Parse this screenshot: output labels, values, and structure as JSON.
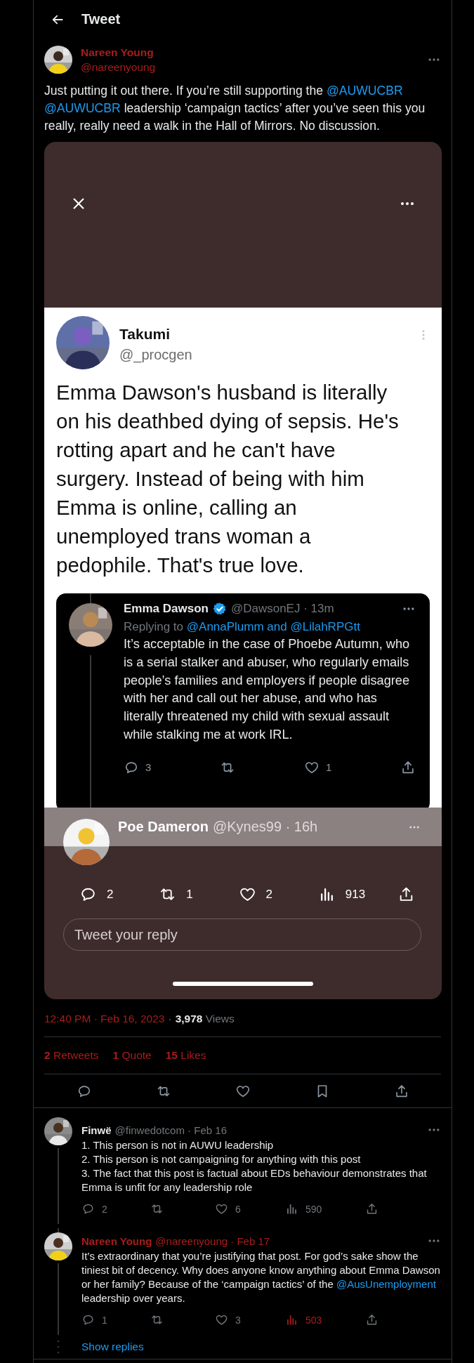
{
  "header": {
    "title": "Tweet"
  },
  "tweet": {
    "name": "Nareen Young",
    "handle": "@nareenyoung",
    "color": "#a81c1c",
    "text": [
      {
        "kind": "text",
        "text": "Just putting it out there. If you’re still supporting the "
      },
      {
        "kind": "link",
        "text": "@AUWUCBR"
      },
      {
        "kind": "link",
        "text": "@AUWUCBR"
      },
      {
        "kind": "text",
        "text": " leadership ‘campaign tactics’ after you’ve seen this you really, really need a walk in the Hall of Mirrors. No discussion."
      }
    ]
  },
  "media": {
    "post": {
      "name": "Takumi",
      "handle": "@_procgen",
      "text": "Emma Dawson's husband is literally on his deathbed dying of sepsis. He's rotting apart and he can't have surgery. Instead of being with him Emma is online, calling an unemployed trans woman a pedophile. That's true love."
    },
    "quote": {
      "name": "Emma Dawson",
      "verified": true,
      "meta": "@DawsonEJ · 13m",
      "replying_prefix": "Replying to",
      "replying_to": "@AnnaPlumm and @LilahRPGtt",
      "text": "It’s acceptable in the case of Phoebe Autumn, who is a serial stalker and abuser, who regularly emails people’s families and employers if people disagree with her and call out her abuse, and who has literally threatened my child with sexual assault while stalking me at work IRL.",
      "actions": [
        {
          "kind": "reply",
          "count": "3"
        },
        {
          "kind": "retweet"
        },
        {
          "kind": "like",
          "count": "1"
        },
        {
          "kind": "share"
        }
      ]
    },
    "overlay_reply": {
      "name": "Poe Dameron",
      "meta": "@Kynes99 · 16h"
    },
    "actions": [
      {
        "kind": "reply",
        "count": "2"
      },
      {
        "kind": "retweet",
        "count": "1"
      },
      {
        "kind": "like",
        "count": "2"
      },
      {
        "kind": "views",
        "count": "913"
      },
      {
        "kind": "share"
      }
    ],
    "reply_field": {
      "placeholder": "Tweet your reply"
    }
  },
  "timestamp": {
    "time": "12:40 PM · Feb 16, 2023",
    "separator": "·",
    "views_count": "3,978",
    "views_label": "Views"
  },
  "stats": [
    {
      "count": "2",
      "label": "Retweets"
    },
    {
      "count": "1",
      "label": "Quote"
    },
    {
      "count": "15",
      "label": "Likes"
    }
  ],
  "action_bar": [
    {
      "kind": "reply"
    },
    {
      "kind": "retweet"
    },
    {
      "kind": "like"
    },
    {
      "kind": "bookmark"
    },
    {
      "kind": "share"
    }
  ],
  "replies": [
    {
      "name": "Finwë",
      "meta": "@finwedotcom · Feb 16",
      "color": "#e7e9ea",
      "text": [
        {
          "kind": "text",
          "text": "1. This person is not in AUWU leadership\n2. This person is not campaigning for anything with this post\n3. The fact that this post is factual about EDs behaviour demonstrates that Emma is unfit for any leadership role"
        }
      ],
      "actions": [
        {
          "kind": "reply",
          "count": "2",
          "highlighted": false
        },
        {
          "kind": "retweet",
          "highlighted": false
        },
        {
          "kind": "like",
          "count": "6",
          "highlighted": false
        },
        {
          "kind": "views",
          "count": "590",
          "highlighted": false
        },
        {
          "kind": "share",
          "highlighted": false
        }
      ]
    },
    {
      "name": "Nareen Young",
      "meta": "@nareenyoung · Feb 17",
      "color": "#a81c1c",
      "text": [
        {
          "kind": "text",
          "text": "It’s extraordinary that you’re justifying that post. For god’s sake show the tiniest bit of decency. Why does anyone know anything about Emma Dawson or her family? Because of the ‘campaign tactics’ of the "
        },
        {
          "kind": "link",
          "text": "@AusUnemployment"
        },
        {
          "kind": "text",
          "text": " leadership over years."
        }
      ],
      "actions": [
        {
          "kind": "reply",
          "count": "1",
          "highlighted": false
        },
        {
          "kind": "retweet",
          "highlighted": false
        },
        {
          "kind": "like",
          "count": "3",
          "highlighted": false
        },
        {
          "kind": "views",
          "count": "503",
          "highlighted": true
        },
        {
          "kind": "share",
          "highlighted": false
        }
      ]
    }
  ],
  "show_replies": "Show replies"
}
